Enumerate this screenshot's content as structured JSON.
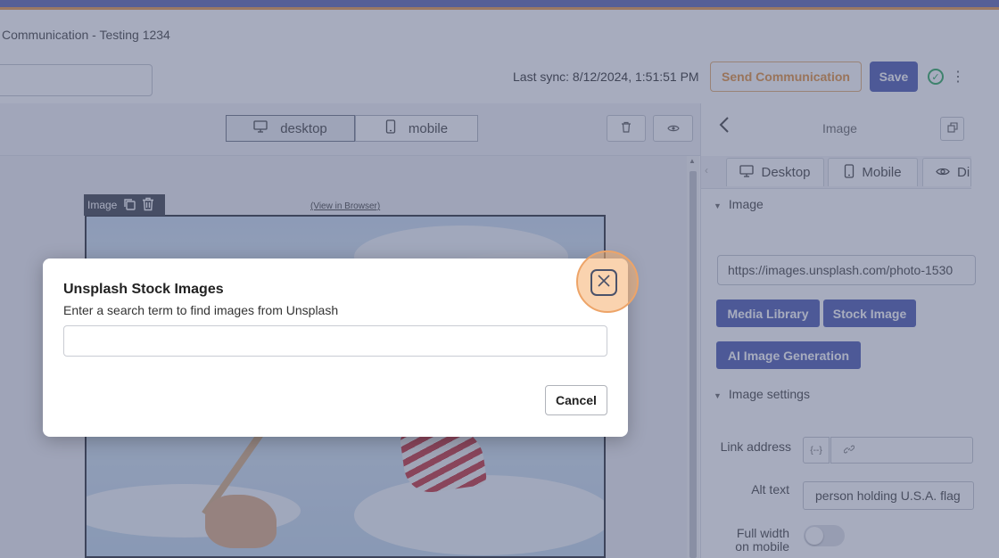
{
  "header": {
    "title": "Communication - Testing 1234",
    "last_sync": "Last sync: 8/12/2024, 1:51:51 PM",
    "send_label": "Send Communication",
    "save_label": "Save"
  },
  "toolbar": {
    "desktop_label": "desktop",
    "mobile_label": "mobile"
  },
  "canvas": {
    "image_tag_label": "Image",
    "view_in_browser": "(View in Browser)"
  },
  "panel": {
    "title": "Image",
    "tabs": [
      {
        "label": "Desktop",
        "icon": "desktop-icon"
      },
      {
        "label": "Mobile",
        "icon": "mobile-icon"
      },
      {
        "label": "Di",
        "icon": "eye-icon"
      }
    ],
    "image_section": "Image",
    "image_url": "https://images.unsplash.com/photo-1530",
    "media_library_label": "Media Library",
    "stock_image_label": "Stock Image",
    "ai_image_label": "AI Image Generation",
    "image_settings_section": "Image settings",
    "link_address_label": "Link address",
    "var_button": "{--}",
    "alt_text_label": "Alt text",
    "alt_text_value": "person holding U.S.A. flag",
    "full_width_label_1": "Full width",
    "full_width_label_2": "on mobile",
    "full_width_on": false
  },
  "modal": {
    "title": "Unsplash Stock Images",
    "subtitle": "Enter a search term to find images from Unsplash",
    "search_value": "",
    "cancel_label": "Cancel"
  },
  "colors": {
    "accent": "#5c69b8",
    "send_orange": "#e59a4b",
    "success_green": "#40b26c",
    "highlight_orange": "#eda468"
  }
}
